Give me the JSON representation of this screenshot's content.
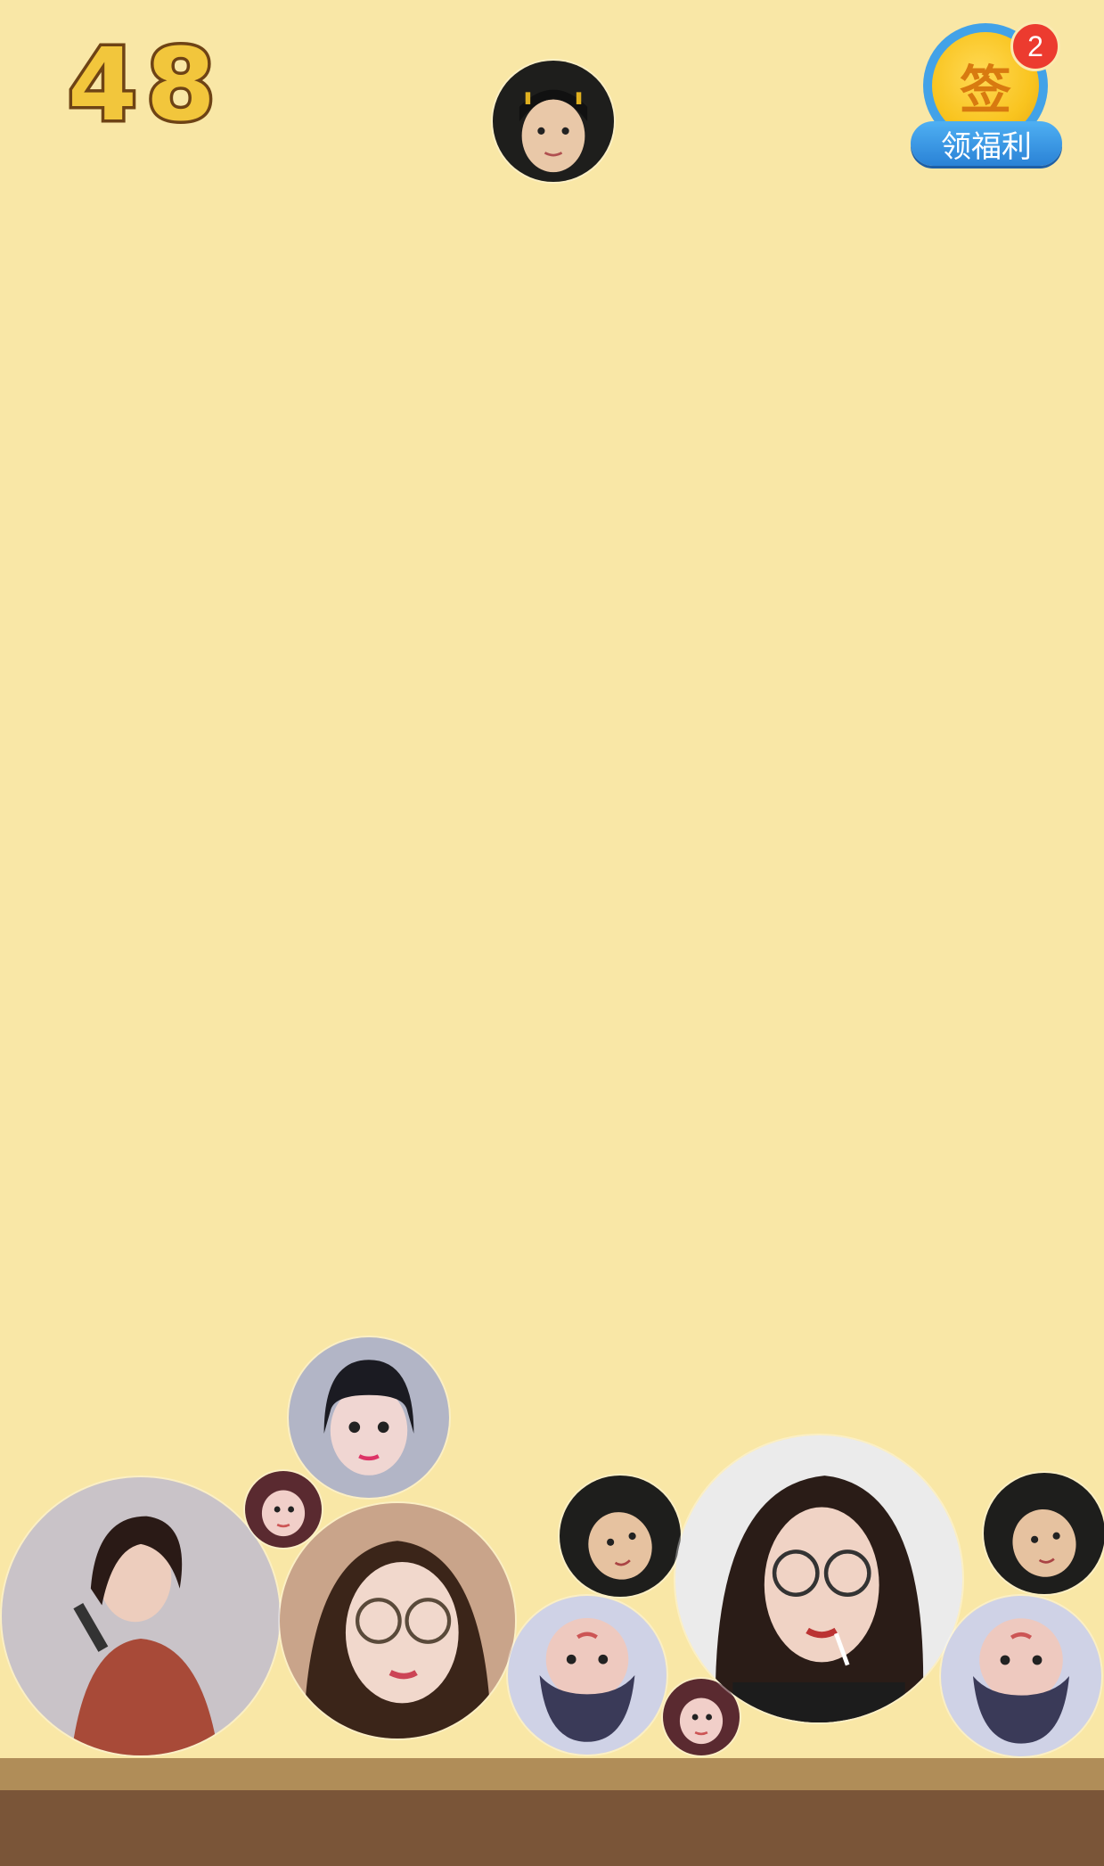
{
  "hud": {
    "score": "48",
    "welfare": {
      "coin_text": "签",
      "badge_count": "2",
      "label": "领福利"
    }
  },
  "next_ball": {
    "icon": "girl-child-portrait"
  },
  "balls": [
    {
      "icon": "singer-red-dress-portrait"
    },
    {
      "icon": "baby-portrait"
    },
    {
      "icon": "bangs-girl-portrait"
    },
    {
      "icon": "glasses-girl-portrait"
    },
    {
      "icon": "child-portrait"
    },
    {
      "icon": "upside-down-child-portrait"
    },
    {
      "icon": "baby-portrait"
    },
    {
      "icon": "glasses-lollipop-girl-portrait"
    },
    {
      "icon": "child-portrait"
    },
    {
      "icon": "upside-down-child-portrait"
    }
  ],
  "colors": {
    "background": "#f9e7a6",
    "ground_top": "#b08d58",
    "ground_bottom": "#7a5538",
    "score_fill": "#f2c63c",
    "score_stroke": "#6e4315"
  }
}
